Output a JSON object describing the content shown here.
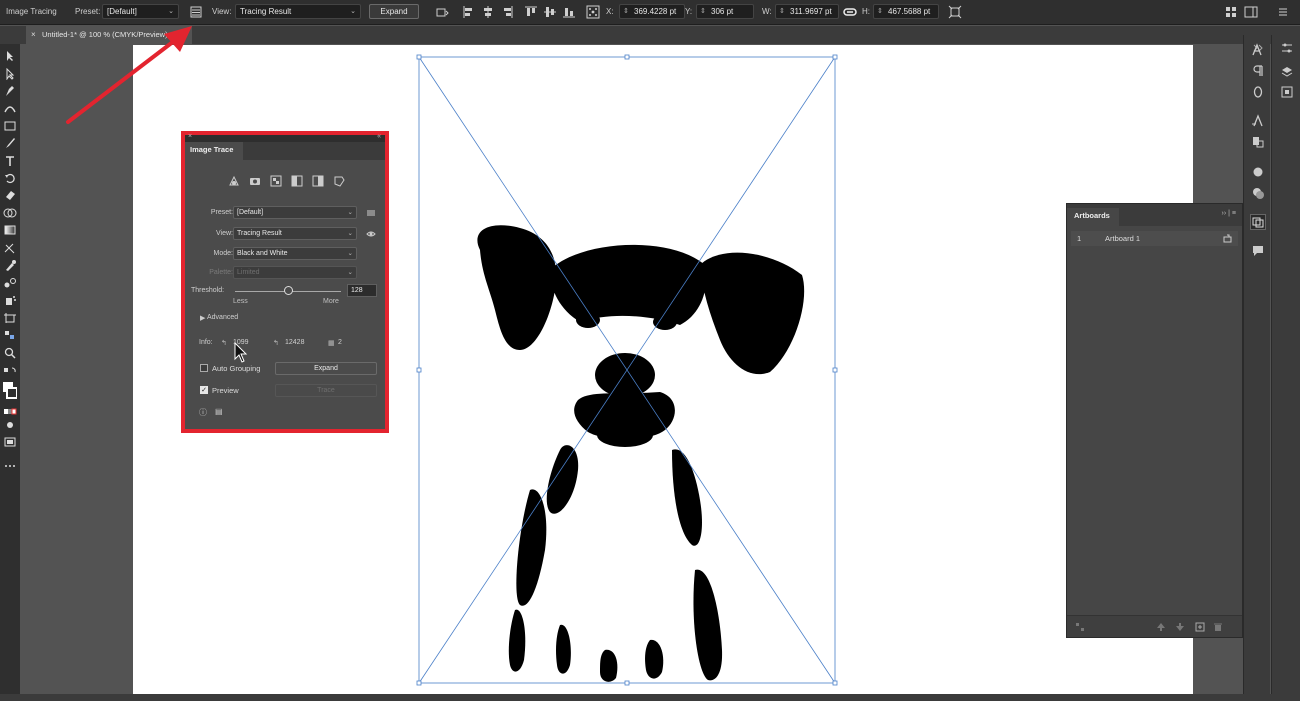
{
  "control_bar": {
    "mode_label": "Image Tracing",
    "preset_label": "Preset:",
    "preset_value": "[Default]",
    "view_label": "View:",
    "view_value": "Tracing Result",
    "expand_label": "Expand",
    "x_label": "X:",
    "x_value": "369.4228 pt",
    "y_label": "Y:",
    "y_value": "306 pt",
    "w_label": "W:",
    "w_value": "311.9697 pt",
    "h_label": "H:",
    "h_value": "467.5688 pt"
  },
  "document_tab": {
    "title": "Untitled-1* @ 100 % (CMYK/Preview)",
    "close": "×"
  },
  "image_trace": {
    "title": "Image Trace",
    "preset_label": "Preset:",
    "preset_value": "[Default]",
    "view_label": "View:",
    "view_value": "Tracing Result",
    "mode_label": "Mode:",
    "mode_value": "Black and White",
    "palette_label": "Palette:",
    "palette_value": "Limited",
    "threshold_label": "Threshold:",
    "threshold_value": "128",
    "threshold_fraction": 0.5,
    "less_label": "Less",
    "more_label": "More",
    "advanced_label": "Advanced",
    "info_label": "Info:",
    "paths_count": "1099",
    "anchors_count": "12428",
    "colors_count": "2",
    "auto_grouping_label": "Auto Grouping",
    "auto_grouping_checked": false,
    "expand_label": "Expand",
    "preview_label": "Preview",
    "preview_checked": true,
    "trace_label": "Trace"
  },
  "artboards_panel": {
    "title": "Artboards",
    "rows": [
      {
        "number": "1",
        "name": "Artboard 1"
      }
    ]
  },
  "colors": {
    "highlight": "#e3242f",
    "selection": "#4a7fc8",
    "arrow": "#e3242f"
  }
}
